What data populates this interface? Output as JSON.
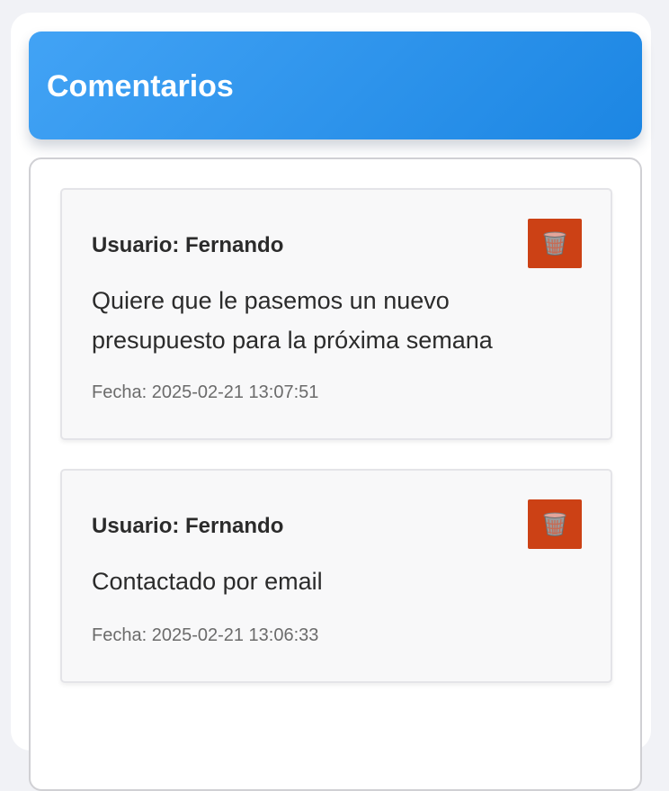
{
  "header": {
    "title": "Comentarios"
  },
  "comments": [
    {
      "user": "Usuario: Fernando",
      "text": "Quiere que le pasemos un nuevo presupuesto para la próxima semana",
      "date": "Fecha: 2025-02-21 13:07:51",
      "delete_icon": "wastebasket-icon"
    },
    {
      "user": "Usuario: Fernando",
      "text": "Contactado por email",
      "date": "Fecha: 2025-02-21 13:06:33",
      "delete_icon": "wastebasket-icon"
    }
  ],
  "colors": {
    "header_gradient_start": "#42a3f5",
    "header_gradient_end": "#1c86e3",
    "delete_button": "#cc4115",
    "page_background": "#f1f2f6"
  }
}
